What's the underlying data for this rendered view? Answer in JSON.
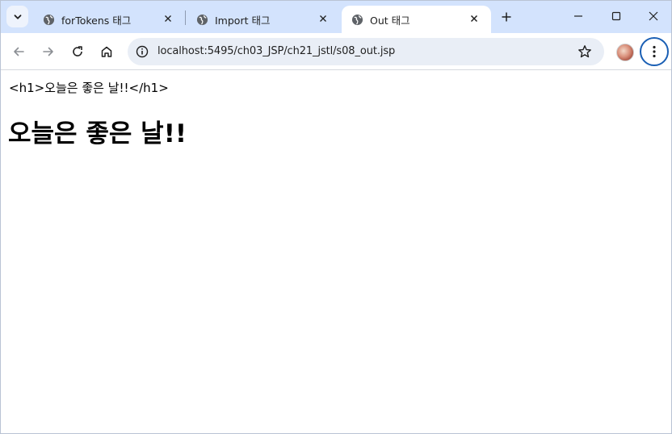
{
  "tabs": [
    {
      "title": "forTokens 태그",
      "active": false
    },
    {
      "title": "Import 태그",
      "active": false
    },
    {
      "title": "Out 태그",
      "active": true
    }
  ],
  "address_bar": {
    "url": "localhost:5495/ch03_JSP/ch21_jstl/s08_out.jsp"
  },
  "icons": {
    "tab_search": "chevron-down-icon",
    "tab_favicon": "globe-icon",
    "tab_close": "close-icon",
    "new_tab": "plus-icon",
    "minimize": "minimize-icon",
    "maximize": "maximize-icon",
    "window_close": "close-icon",
    "back": "arrow-left-icon",
    "forward": "arrow-right-icon",
    "reload": "reload-icon",
    "home": "home-icon",
    "site_info": "info-icon",
    "bookmark": "star-icon",
    "profile": "avatar",
    "menu": "more-vert-icon"
  },
  "colors": {
    "tabstrip_bg": "#d3e3fd",
    "active_tab_bg": "#ffffff",
    "omnibox_bg": "#e9eef6",
    "menu_ring": "#1a5fb4"
  },
  "page": {
    "raw_text": "<h1>오늘은 좋은 날!!</h1>",
    "heading": "오늘은 좋은 날!!"
  }
}
